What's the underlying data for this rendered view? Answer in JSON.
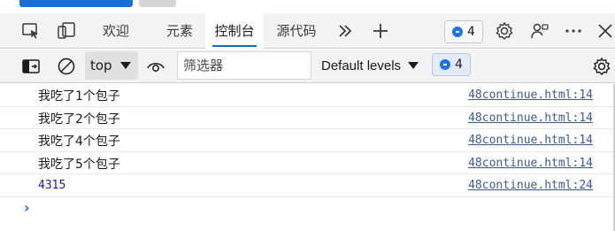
{
  "tabs": [
    {
      "label": "欢迎"
    },
    {
      "label": "元素"
    },
    {
      "label": "控制台"
    },
    {
      "label": "源代码"
    }
  ],
  "active_tab": "控制台",
  "issues_count": "4",
  "toolbar": {
    "context": "top",
    "filter_placeholder": "筛选器",
    "levels": "Default levels",
    "issues_count": "4"
  },
  "console": {
    "messages": [
      {
        "text": "我吃了1个包子",
        "source": "48continue.html:14"
      },
      {
        "text": "我吃了2个包子",
        "source": "48continue.html:14"
      },
      {
        "text": "我吃了4个包子",
        "source": "48continue.html:14"
      },
      {
        "text": "我吃了5个包子",
        "source": "48continue.html:14"
      },
      {
        "text": "4315",
        "source": "48continue.html:24"
      }
    ],
    "prompt": "›"
  },
  "colors": {
    "accent": "#0f6cbd",
    "link": "#3d5a96",
    "number": "#1a1aa6"
  }
}
